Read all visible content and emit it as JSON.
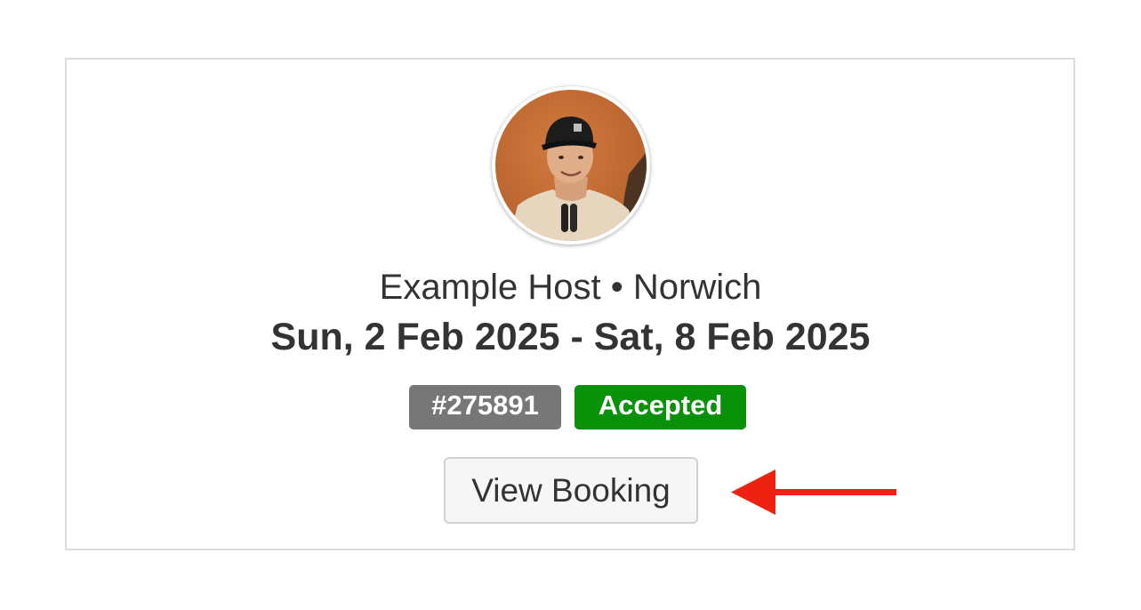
{
  "booking": {
    "host_line": "Example Host • Norwich",
    "dates": "Sun, 2 Feb 2025 - Sat, 8 Feb 2025",
    "booking_id": "#275891",
    "status": "Accepted",
    "view_button_label": "View Booking"
  },
  "icons": {
    "avatar": "host-avatar-photo",
    "pointer": "red-arrow-left-icon"
  },
  "colors": {
    "id_badge": "#777777",
    "status_badge": "#099209",
    "arrow": "#ee2211",
    "card_border": "#dcdcdc"
  }
}
